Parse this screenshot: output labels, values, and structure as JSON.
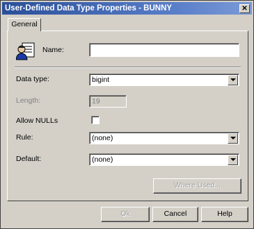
{
  "window": {
    "title": "User-Defined Data Type Properties - BUNNY",
    "close_label": "✕"
  },
  "tabs": [
    {
      "label": "General"
    }
  ],
  "form": {
    "name_label": "Name:",
    "name_value": "",
    "datatype_label": "Data type:",
    "datatype_value": "bigint",
    "length_label": "Length:",
    "length_value": "19",
    "allow_nulls_label": "Allow NULLs",
    "allow_nulls_checked": false,
    "rule_label": "Rule:",
    "rule_value": "(none)",
    "default_label": "Default:",
    "default_value": "(none)",
    "where_used_label": "Where Used..."
  },
  "buttons": {
    "ok_label": "Ok",
    "cancel_label": "Cancel",
    "help_label": "Help"
  },
  "icons": {
    "type_icon": "user-defined-type-icon",
    "close": "close-icon",
    "dropdown": "chevron-down-icon"
  }
}
